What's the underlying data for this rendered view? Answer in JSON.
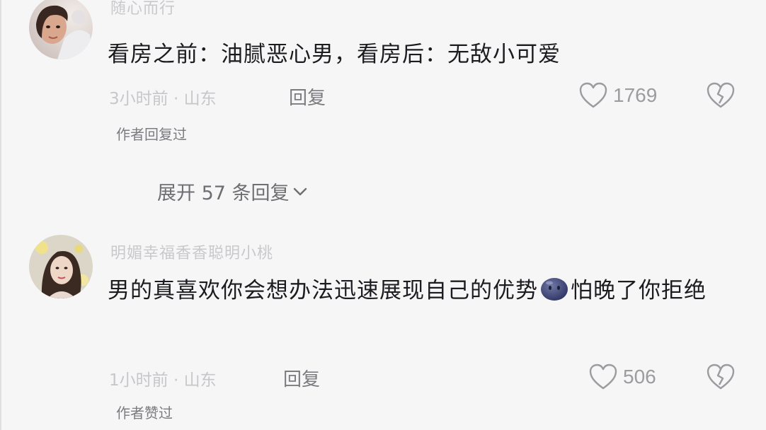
{
  "comments": [
    {
      "username": "随心而行",
      "text": "看房之前：油腻恶心男，看房后：无敌小可爱",
      "time_location": "3小时前 · 山东",
      "reply_label": "回复",
      "likes": "1769",
      "author_note": "作者回复过",
      "expand_label": "展开 57 条回复"
    },
    {
      "username": "明媚幸福香香聪明小桃",
      "text_part1": "男的真喜欢你会想办法迅速展现自己的优势",
      "text_part2": "怕晚了你拒绝",
      "time_location": "1小时前 · 山东",
      "reply_label": "回复",
      "likes": "506",
      "author_note": "作者赞过"
    }
  ],
  "icons": {
    "like": "heart-outline-icon",
    "dislike": "broken-heart-icon",
    "expand": "chevron-down-icon",
    "emoji": "blue-face-emoji"
  },
  "colors": {
    "background": "#f6f6f7",
    "text": "#1c1c20",
    "muted": "#c7c7cb",
    "secondary": "#7b7b80"
  }
}
